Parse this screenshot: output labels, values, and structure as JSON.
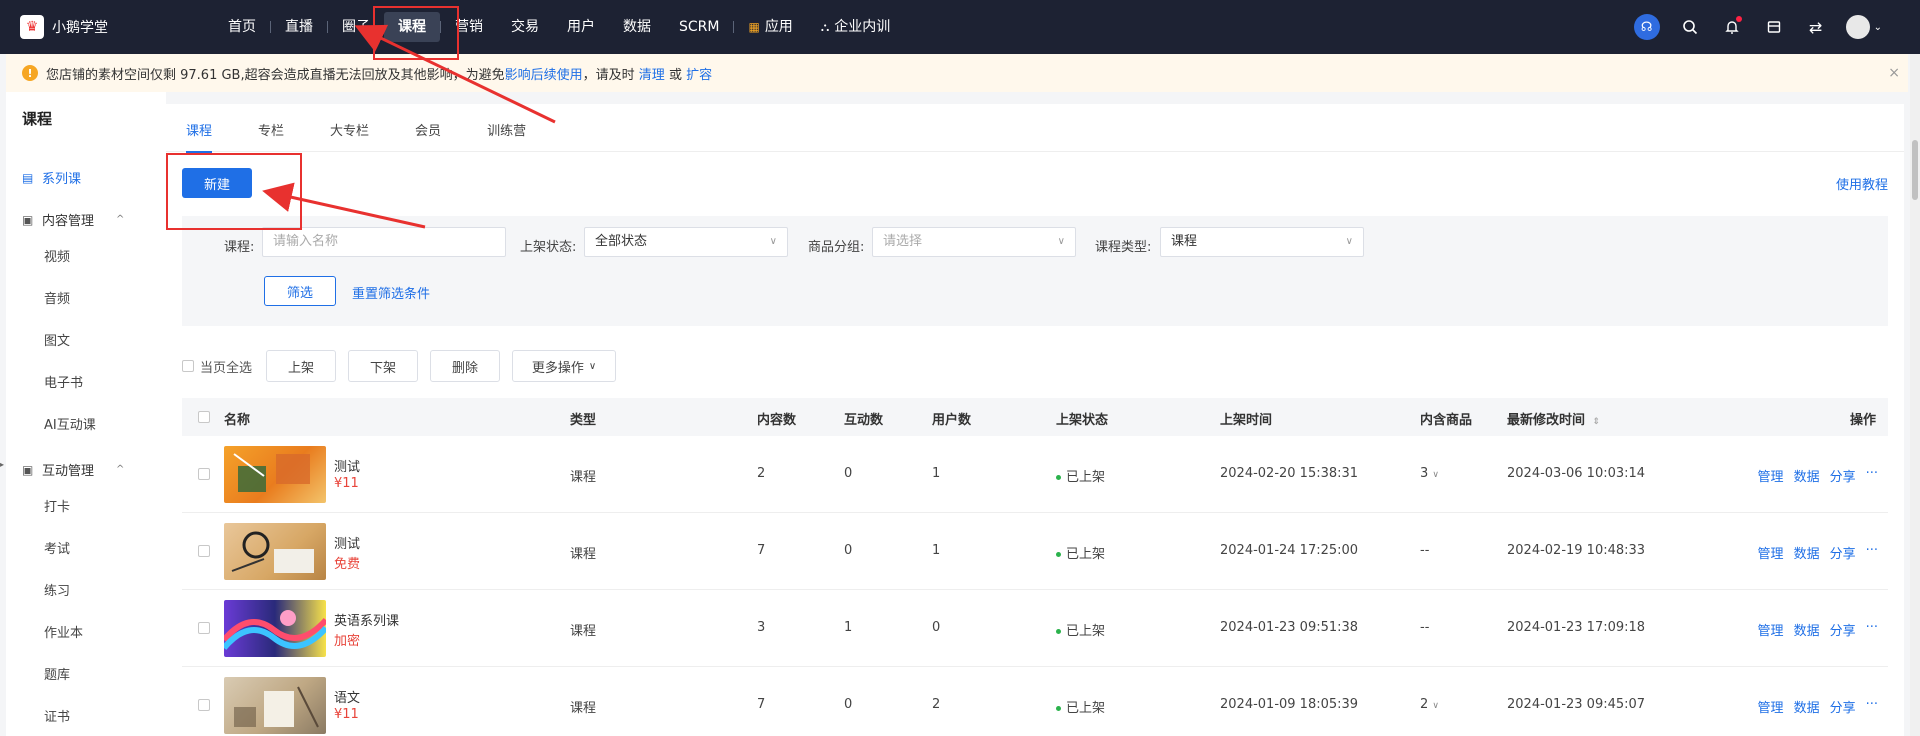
{
  "brand": {
    "name": "小鹅学堂"
  },
  "nav": {
    "items": [
      "首页",
      "直播",
      "圈子",
      "课程",
      "营销",
      "交易",
      "用户",
      "数据",
      "SCRM",
      "应用",
      "企业内训"
    ]
  },
  "notice": {
    "text": "您店铺的素材空间仅剩 97.61 GB,超容会造成直播无法回放及其他影响，为避免",
    "link1": "影响后续使用",
    "mid": "，请及时",
    "link2": "清理",
    "or": "或",
    "link3": "扩容",
    "close": "×"
  },
  "sidebar": {
    "title": "课程",
    "series": "系列课",
    "content_group": "内容管理",
    "content_items": [
      "视频",
      "音频",
      "图文",
      "电子书",
      "AI互动课"
    ],
    "interact_group": "互动管理",
    "interact_items": [
      "打卡",
      "考试",
      "练习",
      "作业本",
      "题库",
      "证书"
    ]
  },
  "tabs": [
    "课程",
    "专栏",
    "大专栏",
    "会员",
    "训练营"
  ],
  "toolbar": {
    "new_label": "新建",
    "tutorial": "使用教程"
  },
  "filter": {
    "course_label": "课程:",
    "course_placeholder": "请输入名称",
    "status_label": "上架状态:",
    "status_value": "全部状态",
    "group_label": "商品分组:",
    "group_placeholder": "请选择",
    "type_label": "课程类型:",
    "type_value": "课程",
    "filter_btn": "筛选",
    "reset": "重置筛选条件"
  },
  "bulk": {
    "select_all": "当页全选",
    "on": "上架",
    "off": "下架",
    "delete": "删除",
    "more": "更多操作"
  },
  "table": {
    "headers": {
      "name": "名称",
      "type": "类型",
      "content": "内容数",
      "interact": "互动数",
      "users": "用户数",
      "status": "上架状态",
      "time": "上架时间",
      "goods": "内含商品",
      "modified": "最新修改时间",
      "ops": "操作"
    },
    "ops": {
      "manage": "管理",
      "data": "数据",
      "share": "分享",
      "more": "···"
    },
    "rows": [
      {
        "name": "测试",
        "price": "¥11",
        "type": "课程",
        "content": "2",
        "interact": "0",
        "users": "1",
        "status": "已上架",
        "time": "2024-02-20 15:38:31",
        "goods": "3",
        "modified": "2024-03-06 10:03:14"
      },
      {
        "name": "测试",
        "price": "免费",
        "type": "课程",
        "content": "7",
        "interact": "0",
        "users": "1",
        "status": "已上架",
        "time": "2024-01-24 17:25:00",
        "goods": "--",
        "modified": "2024-02-19 10:48:33"
      },
      {
        "name": "英语系列课",
        "price": "加密",
        "type": "课程",
        "content": "3",
        "interact": "1",
        "users": "0",
        "status": "已上架",
        "time": "2024-01-23 09:51:38",
        "goods": "--",
        "modified": "2024-01-23 17:09:18"
      },
      {
        "name": "语文",
        "price": "¥11",
        "type": "课程",
        "content": "7",
        "interact": "0",
        "users": "2",
        "status": "已上架",
        "time": "2024-01-09 18:05:39",
        "goods": "2",
        "modified": "2024-01-23 09:45:07"
      }
    ]
  },
  "colors": {
    "accent": "#1f6fe6",
    "nav_bg": "#1d2233",
    "annotation": "#e8312f",
    "price": "#e8443a"
  }
}
